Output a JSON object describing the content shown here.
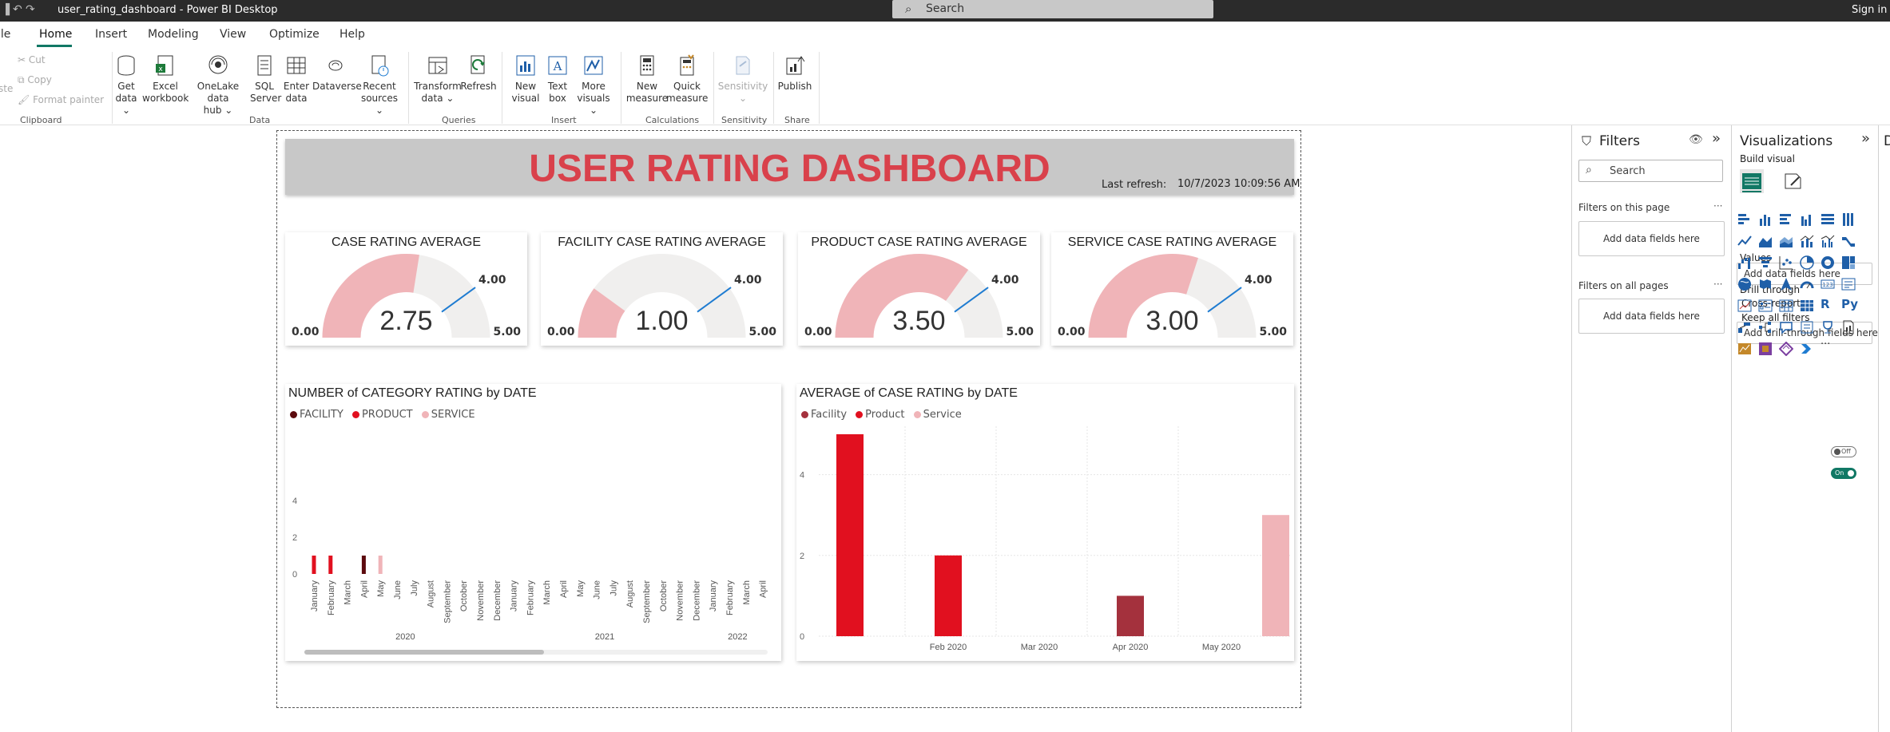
{
  "window": {
    "title": "user_rating_dashboard - Power BI Desktop",
    "search_label": "Search",
    "signin_label": "Sign in"
  },
  "menu": {
    "tabs": [
      "ile",
      "Home",
      "Insert",
      "Modeling",
      "View",
      "Optimize",
      "Help"
    ],
    "active": "Home"
  },
  "ribbon": {
    "clipboard": {
      "cut": "Cut",
      "copy": "Copy",
      "format_painter": "Format painter",
      "paste_fragment": "ste",
      "group": "Clipboard"
    },
    "data": {
      "group": "Data",
      "buttons": [
        {
          "line1": "Get",
          "line2": "data ⌄"
        },
        {
          "line1": "Excel",
          "line2": "workbook"
        },
        {
          "line1": "OneLake data",
          "line2": "hub ⌄"
        },
        {
          "line1": "SQL",
          "line2": "Server"
        },
        {
          "line1": "Enter",
          "line2": "data"
        },
        {
          "line1": "Dataverse",
          "line2": ""
        },
        {
          "line1": "Recent",
          "line2": "sources ⌄"
        }
      ]
    },
    "queries": {
      "group": "Queries",
      "buttons": [
        {
          "line1": "Transform",
          "line2": "data ⌄"
        },
        {
          "line1": "Refresh",
          "line2": ""
        }
      ]
    },
    "insert": {
      "group": "Insert",
      "buttons": [
        {
          "line1": "New",
          "line2": "visual"
        },
        {
          "line1": "Text",
          "line2": "box"
        },
        {
          "line1": "More",
          "line2": "visuals ⌄"
        }
      ]
    },
    "calculations": {
      "group": "Calculations",
      "buttons": [
        {
          "line1": "New",
          "line2": "measure"
        },
        {
          "line1": "Quick",
          "line2": "measure"
        }
      ]
    },
    "sensitivity": {
      "group": "Sensitivity",
      "line1": "Sensitivity",
      "line2": "⌄"
    },
    "share": {
      "group": "Share",
      "line1": "Publish"
    }
  },
  "report": {
    "title": "USER RATING DASHBOARD",
    "last_refresh_label": "Last refresh:",
    "last_refresh_value": "10/7/2023 10:09:56 AM",
    "colors": {
      "title": "#d9414b",
      "gauge_fill": "#f0b4b8",
      "gauge_bg": "#f0efee",
      "target": "#1f7cd1",
      "facility_bar": "#a4313d",
      "product_bar": "#e1101f",
      "service_bar": "#f0b4b8",
      "facility_legend_1": "#5c0a0e"
    },
    "gauges": [
      {
        "title": "CASE RATING AVERAGE",
        "value": 2.75,
        "value_label": "2.75",
        "min": 0,
        "max": 5,
        "target": 4,
        "min_label": "0.00",
        "max_label": "5.00",
        "target_label": "4.00"
      },
      {
        "title": "FACILITY CASE RATING AVERAGE",
        "value": 1.0,
        "value_label": "1.00",
        "min": 0,
        "max": 5,
        "target": 4,
        "min_label": "0.00",
        "max_label": "5.00",
        "target_label": "4.00"
      },
      {
        "title": "PRODUCT CASE RATING AVERAGE",
        "value": 3.5,
        "value_label": "3.50",
        "min": 0,
        "max": 5,
        "target": 4,
        "min_label": "0.00",
        "max_label": "5.00",
        "target_label": "4.00"
      },
      {
        "title": "SERVICE CASE RATING AVERAGE",
        "value": 3.0,
        "value_label": "3.00",
        "min": 0,
        "max": 5,
        "target": 4,
        "min_label": "0.00",
        "max_label": "5.00",
        "target_label": "4.00"
      }
    ]
  },
  "chart_data": [
    {
      "type": "bar",
      "title": "NUMBER of CATEGORY RATING by DATE",
      "legend": [
        {
          "name": "FACILITY",
          "color": "#5c0a0e"
        },
        {
          "name": "PRODUCT",
          "color": "#e1101f"
        },
        {
          "name": "SERVICE",
          "color": "#f0b4b8"
        }
      ],
      "ylim": [
        0,
        4
      ],
      "yticks": [
        0,
        2,
        4
      ],
      "categories": [
        "January",
        "February",
        "March",
        "April",
        "May",
        "June",
        "July",
        "August",
        "September",
        "October",
        "November",
        "December",
        "January",
        "February",
        "March",
        "April",
        "May",
        "June",
        "July",
        "August",
        "September",
        "October",
        "November",
        "December",
        "January",
        "February",
        "March",
        "April"
      ],
      "year_groups": [
        {
          "label": "2020",
          "start": 0,
          "end": 11
        },
        {
          "label": "2021",
          "start": 12,
          "end": 23
        },
        {
          "label": "2022",
          "start": 24,
          "end": 27
        }
      ],
      "series": [
        {
          "name": "FACILITY",
          "values": [
            0,
            0,
            0,
            1,
            0,
            0,
            0,
            0,
            0,
            0,
            0,
            0,
            0,
            0,
            0,
            0,
            0,
            0,
            0,
            0,
            0,
            0,
            0,
            0,
            0,
            0,
            0,
            0
          ]
        },
        {
          "name": "PRODUCT",
          "values": [
            1,
            1,
            0,
            0,
            0,
            0,
            0,
            0,
            0,
            0,
            0,
            0,
            0,
            0,
            0,
            0,
            0,
            0,
            0,
            0,
            0,
            0,
            0,
            0,
            0,
            0,
            0,
            0
          ]
        },
        {
          "name": "SERVICE",
          "values": [
            0,
            0,
            0,
            0,
            1,
            0,
            0,
            0,
            0,
            0,
            0,
            0,
            0,
            0,
            0,
            0,
            0,
            0,
            0,
            0,
            0,
            0,
            0,
            0,
            0,
            0,
            0,
            0
          ]
        }
      ],
      "grid": false
    },
    {
      "type": "bar",
      "title": "AVERAGE of CASE RATING by DATE",
      "legend": [
        {
          "name": "Facility",
          "color": "#a4313d"
        },
        {
          "name": "Product",
          "color": "#e1101f"
        },
        {
          "name": "Service",
          "color": "#f0b4b8"
        }
      ],
      "ylim": [
        0,
        5
      ],
      "yticks": [
        0,
        2,
        4
      ],
      "xticks": [
        "Feb 2020",
        "Mar 2020",
        "Apr 2020",
        "May 2020"
      ],
      "bars": [
        {
          "series": "Product",
          "date": "Jan 2020",
          "value": 5
        },
        {
          "series": "Product",
          "date": "Feb 2020",
          "value": 2
        },
        {
          "series": "Facility",
          "date": "Apr 2020",
          "value": 1
        },
        {
          "series": "Service",
          "date": "May 2020",
          "value": 3
        }
      ],
      "grid": true
    }
  ],
  "filters": {
    "title": "Filters",
    "search_placeholder": "Search",
    "on_this_page": "Filters on this page",
    "on_all_pages": "Filters on all pages",
    "add_fields": "Add data fields here",
    "more": "···"
  },
  "visualizations": {
    "title": "Visualizations",
    "build_visual": "Build visual",
    "values_label": "Values",
    "add_fields": "Add data fields here",
    "drill_through": "Drill through",
    "cross_report": "Cross-report",
    "cross_report_state": "Off",
    "keep_all_filters": "Keep all filters",
    "keep_all_filters_state": "On",
    "add_drill_fields": "Add drill-through fields here",
    "more": "···",
    "r_label": "R",
    "py_label": "Py"
  },
  "data_pane": {
    "title": "D"
  }
}
